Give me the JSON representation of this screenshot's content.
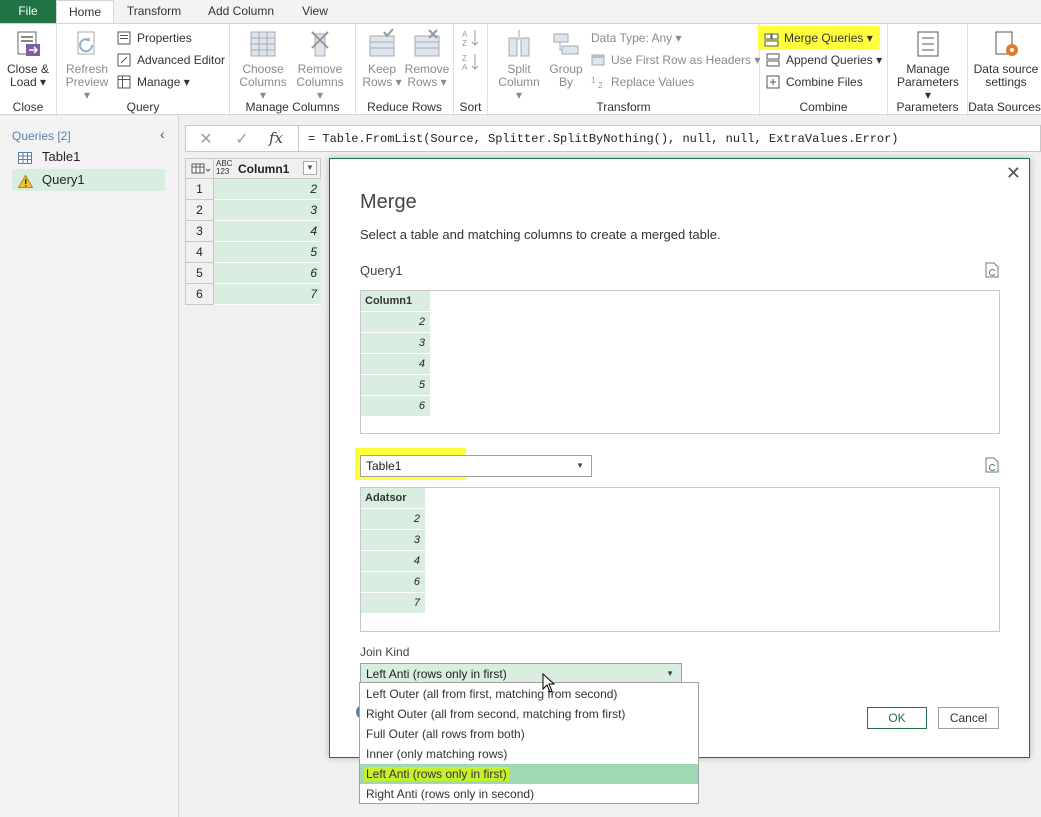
{
  "tabs": {
    "file": "File",
    "home": "Home",
    "transform": "Transform",
    "add_column": "Add Column",
    "view": "View"
  },
  "ribbon": {
    "close_group": {
      "label": "Close",
      "close_load_1": "Close &",
      "close_load_2": "Load"
    },
    "query_group": {
      "label": "Query",
      "refresh_1": "Refresh",
      "refresh_2": "Preview",
      "properties": "Properties",
      "advanced_editor": "Advanced Editor",
      "manage": "Manage"
    },
    "manage_columns_group": {
      "label": "Manage Columns",
      "choose_1": "Choose",
      "choose_2": "Columns",
      "remove_1": "Remove",
      "remove_2": "Columns"
    },
    "reduce_rows_group": {
      "label": "Reduce Rows",
      "keep_1": "Keep",
      "keep_2": "Rows",
      "remove_1": "Remove",
      "remove_2": "Rows"
    },
    "sort_group": {
      "label": "Sort"
    },
    "transform_group": {
      "label": "Transform",
      "split_1": "Split",
      "split_2": "Column",
      "group_1": "Group",
      "group_2": "By",
      "data_type": "Data Type: Any",
      "first_row": "Use First Row as Headers",
      "replace": "Replace Values"
    },
    "combine_group": {
      "label": "Combine",
      "merge": "Merge Queries",
      "append": "Append Queries",
      "combine_files": "Combine Files"
    },
    "parameters_group": {
      "label": "Parameters",
      "manage_1": "Manage",
      "manage_2": "Parameters"
    },
    "data_sources_group": {
      "label": "Data Sources",
      "ds_1": "Data source",
      "ds_2": "settings"
    }
  },
  "queries": {
    "title": "Queries [2]",
    "items": [
      {
        "label": "Table1"
      },
      {
        "label": "Query1"
      }
    ]
  },
  "formula": {
    "text": "= Table.FromList(Source, Splitter.SplitByNothing(), null, null, ExtraValues.Error)",
    "fx": "fx"
  },
  "grid": {
    "type_top": "ABC",
    "type_bottom": "123",
    "column": "Column1",
    "rows": [
      {
        "n": "1",
        "v": "2"
      },
      {
        "n": "2",
        "v": "3"
      },
      {
        "n": "3",
        "v": "4"
      },
      {
        "n": "4",
        "v": "5"
      },
      {
        "n": "5",
        "v": "6"
      },
      {
        "n": "6",
        "v": "7"
      }
    ]
  },
  "dialog": {
    "title": "Merge",
    "description": "Select a table and matching columns to create a merged table.",
    "first_table": "Query1",
    "first_column": "Column1",
    "first_values": [
      "2",
      "3",
      "4",
      "5",
      "6"
    ],
    "second_table": "Table1",
    "second_column": "Adatsor",
    "second_values": [
      "2",
      "3",
      "4",
      "6",
      "7"
    ],
    "join_kind_label": "Join Kind",
    "join_kind_value": "Left Anti (rows only in first)",
    "join_options": [
      "Left Outer (all from first, matching from second)",
      "Right Outer (all from second, matching from first)",
      "Full Outer (all rows from both)",
      "Inner (only matching rows)",
      "Left Anti (rows only in first)",
      "Right Anti (rows only in second)"
    ],
    "ok": "OK",
    "cancel": "Cancel"
  },
  "colors": {
    "accent": "#217346",
    "highlight": "#ffff3c",
    "selected_row": "#d9eee0",
    "dropdown_selected": "#a0d8b3"
  }
}
